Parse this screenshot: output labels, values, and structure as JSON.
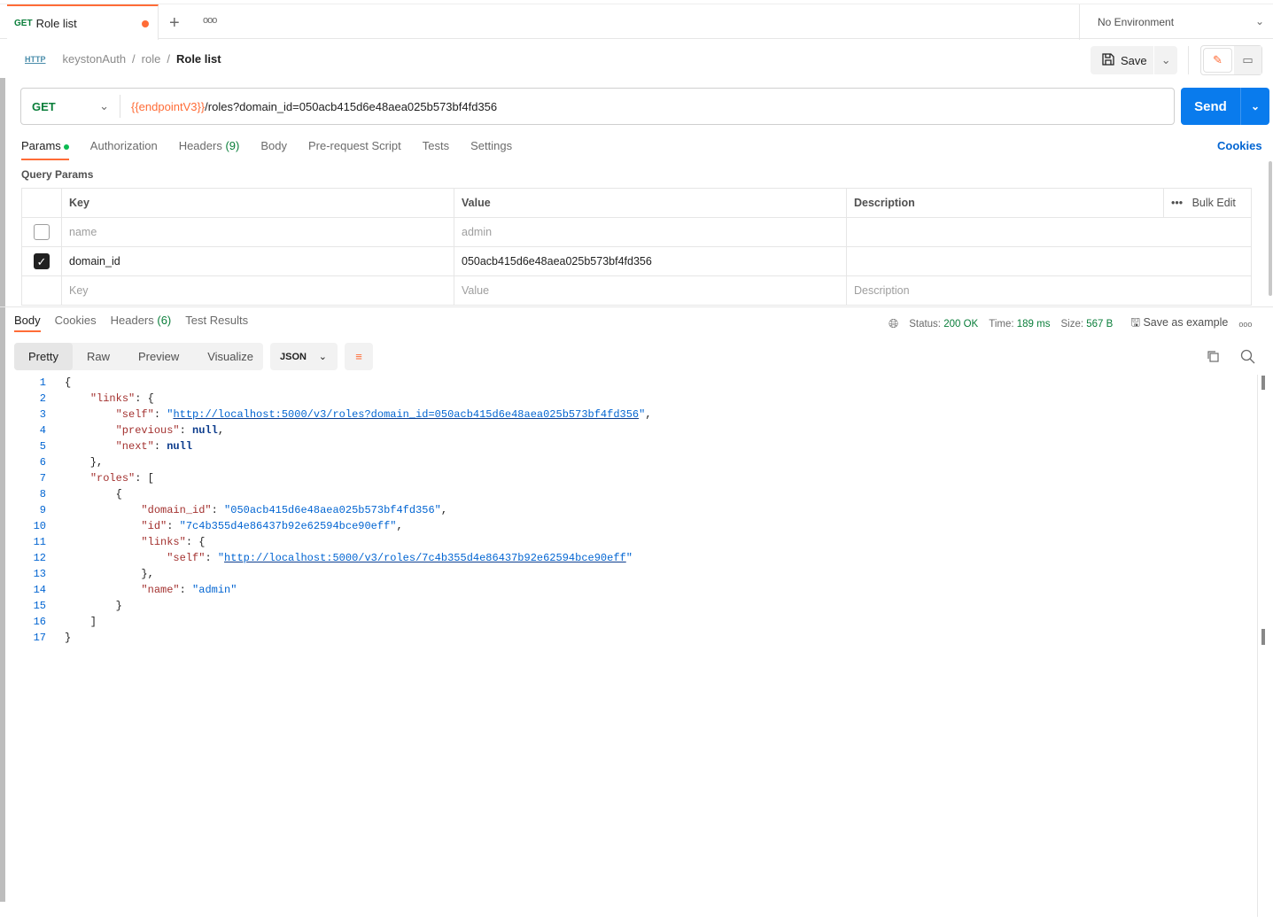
{
  "tab": {
    "method": "GET",
    "title": "Role list",
    "more": "ooo"
  },
  "environment": {
    "label": "No Environment"
  },
  "breadcrumb": {
    "icon": "HTTP",
    "parts": [
      "keystonAuth",
      "role"
    ],
    "current": "Role list"
  },
  "toolbar": {
    "save_label": "Save"
  },
  "request": {
    "method": "GET",
    "url_var": "{{endpointV3}}",
    "url_rest": "/roles?domain_id=050acb415d6e48aea025b573bf4fd356",
    "send_label": "Send"
  },
  "req_tabs": {
    "params": "Params",
    "authorization": "Authorization",
    "headers": "Headers",
    "headers_count": "(9)",
    "body": "Body",
    "prerequest": "Pre-request Script",
    "tests": "Tests",
    "settings": "Settings",
    "cookies": "Cookies"
  },
  "query_params": {
    "title": "Query Params",
    "headers": {
      "key": "Key",
      "value": "Value",
      "description": "Description",
      "bulk_edit": "Bulk Edit"
    },
    "rows": [
      {
        "checked": false,
        "key": "name",
        "value": "admin",
        "description": ""
      },
      {
        "checked": true,
        "key": "domain_id",
        "value": "050acb415d6e48aea025b573bf4fd356",
        "description": ""
      }
    ],
    "placeholder": {
      "key": "Key",
      "value": "Value",
      "description": "Description"
    }
  },
  "response": {
    "tabs": {
      "body": "Body",
      "cookies": "Cookies",
      "headers": "Headers",
      "headers_count": "(6)",
      "test_results": "Test Results"
    },
    "status_label": "Status:",
    "status": "200 OK",
    "time_label": "Time:",
    "time": "189 ms",
    "size_label": "Size:",
    "size": "567 B",
    "save_example": "Save as example",
    "formats": {
      "pretty": "Pretty",
      "raw": "Raw",
      "preview": "Preview",
      "visualize": "Visualize"
    },
    "language": "JSON",
    "lines": [
      [
        [
          "p",
          "{"
        ]
      ],
      [
        [
          "p",
          "    "
        ],
        [
          "key",
          "\"links\""
        ],
        [
          "p",
          ": {"
        ]
      ],
      [
        [
          "p",
          "        "
        ],
        [
          "key",
          "\"self\""
        ],
        [
          "p",
          ": "
        ],
        [
          "str",
          "\""
        ],
        [
          "lnk",
          "http://localhost:5000/v3/roles?domain_id=050acb415d6e48aea025b573bf4fd356"
        ],
        [
          "str",
          "\""
        ],
        [
          "p",
          ","
        ]
      ],
      [
        [
          "p",
          "        "
        ],
        [
          "key",
          "\"previous\""
        ],
        [
          "p",
          ": "
        ],
        [
          "nul",
          "null"
        ],
        [
          "p",
          ","
        ]
      ],
      [
        [
          "p",
          "        "
        ],
        [
          "key",
          "\"next\""
        ],
        [
          "p",
          ": "
        ],
        [
          "nul",
          "null"
        ]
      ],
      [
        [
          "p",
          "    },"
        ]
      ],
      [
        [
          "p",
          "    "
        ],
        [
          "key",
          "\"roles\""
        ],
        [
          "p",
          ": ["
        ]
      ],
      [
        [
          "p",
          "        {"
        ]
      ],
      [
        [
          "p",
          "            "
        ],
        [
          "key",
          "\"domain_id\""
        ],
        [
          "p",
          ": "
        ],
        [
          "str",
          "\"050acb415d6e48aea025b573bf4fd356\""
        ],
        [
          "p",
          ","
        ]
      ],
      [
        [
          "p",
          "            "
        ],
        [
          "key",
          "\"id\""
        ],
        [
          "p",
          ": "
        ],
        [
          "str",
          "\"7c4b355d4e86437b92e62594bce90eff\""
        ],
        [
          "p",
          ","
        ]
      ],
      [
        [
          "p",
          "            "
        ],
        [
          "key",
          "\"links\""
        ],
        [
          "p",
          ": {"
        ]
      ],
      [
        [
          "p",
          "                "
        ],
        [
          "key",
          "\"self\""
        ],
        [
          "p",
          ": "
        ],
        [
          "str",
          "\""
        ],
        [
          "lnk",
          "http://localhost:5000/v3/roles/7c4b355d4e86437b92e62594bce90eff"
        ],
        [
          "str",
          "\""
        ]
      ],
      [
        [
          "p",
          "            },"
        ]
      ],
      [
        [
          "p",
          "            "
        ],
        [
          "key",
          "\"name\""
        ],
        [
          "p",
          ": "
        ],
        [
          "str",
          "\"admin\""
        ]
      ],
      [
        [
          "p",
          "        }"
        ]
      ],
      [
        [
          "p",
          "    ]"
        ]
      ],
      [
        [
          "p",
          "}"
        ]
      ]
    ]
  }
}
